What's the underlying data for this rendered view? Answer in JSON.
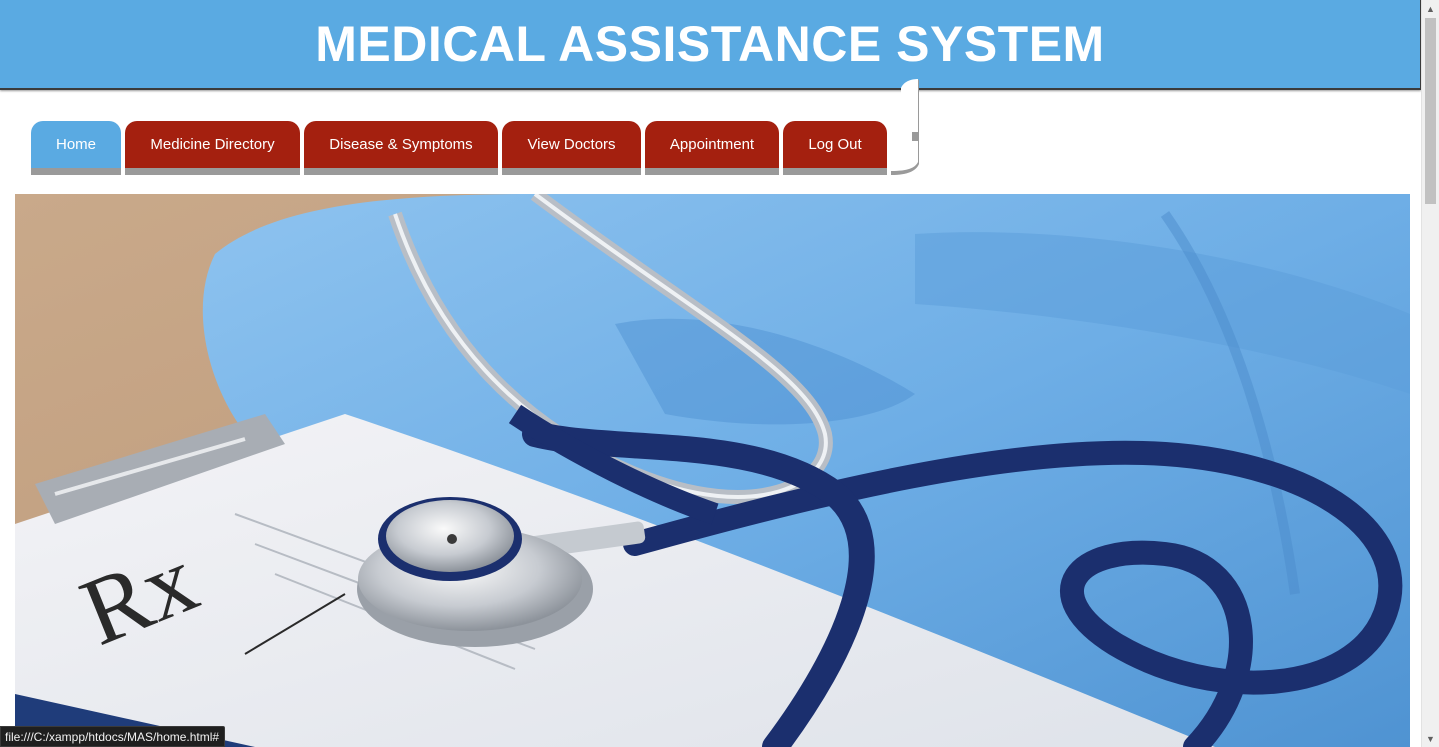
{
  "header": {
    "title": "MEDICAL ASSISTANCE SYSTEM"
  },
  "nav": {
    "items": [
      {
        "label": "Home",
        "active": true
      },
      {
        "label": "Medicine Directory",
        "active": false
      },
      {
        "label": "Disease & Symptoms",
        "active": false
      },
      {
        "label": "View Doctors",
        "active": false
      },
      {
        "label": "Appointment",
        "active": false
      },
      {
        "label": "Log Out",
        "active": false
      }
    ]
  },
  "hero": {
    "image_subject": "stethoscope on prescription clipboard with blue scrubs",
    "prescription_mark": "Rx"
  },
  "status_bar": {
    "url": "file:///C:/xampp/htdocs/MAS/home.html#"
  },
  "colors": {
    "header_bg": "#5aaae2",
    "nav_active_bg": "#5aaae2",
    "nav_bg": "#a4200f",
    "nav_shadow": "#9a9a9a"
  }
}
